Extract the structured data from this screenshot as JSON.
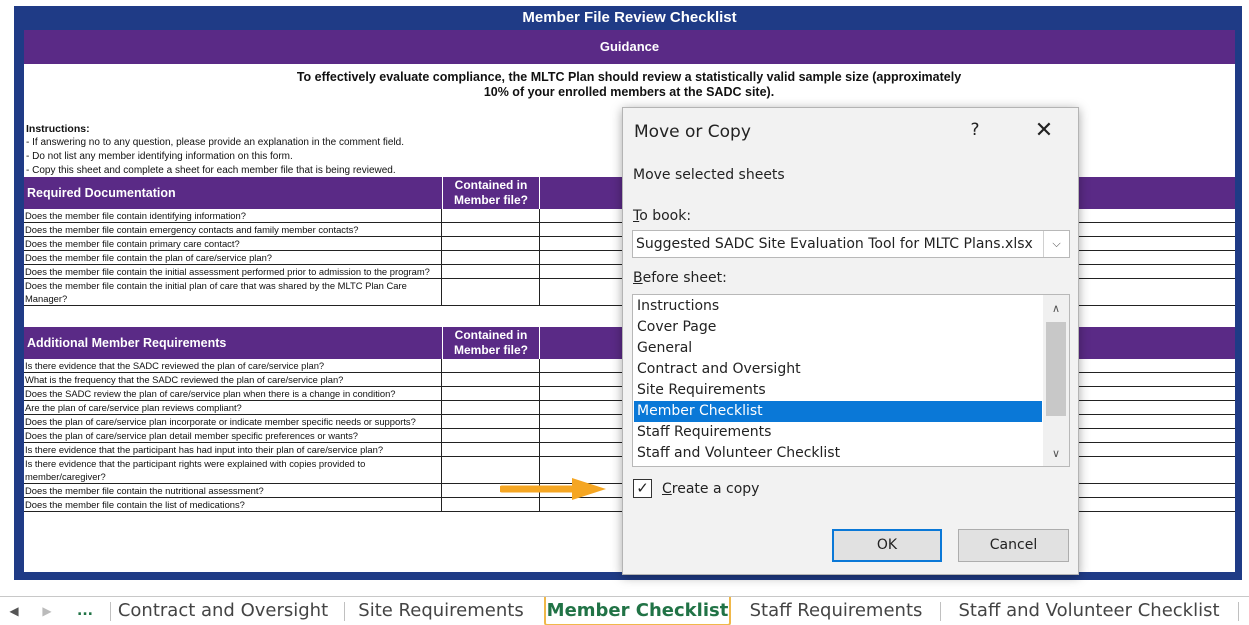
{
  "sheet": {
    "title": "Member File Review Checklist",
    "guidance": "Guidance",
    "intro_line1": "To effectively evaluate compliance, the MLTC Plan should review a statistically valid sample size (approximately",
    "intro_line2": "10% of your enrolled members at the SADC site).",
    "instructions_heading": "Instructions:",
    "instructions": [
      "- If answering no to any question, please provide an explanation in the comment field.",
      "- Do not list any member identifying information on this form.",
      "- Copy this sheet and complete a sheet for each member file that is being reviewed."
    ],
    "section1": {
      "title": "Required Documentation",
      "col_line1": "Contained in",
      "col_line2": "Member file?",
      "rows": [
        "Does the member file contain identifying information?",
        "Does the member file contain emergency contacts and family member contacts?",
        "Does the member file contain primary care contact?",
        "Does the member file contain the plan of care/service plan?",
        "Does the member file contain the initial assessment performed prior to admission to the program?",
        "Does the member file contain the initial plan of care that was shared by the MLTC Plan Care Manager?"
      ]
    },
    "section2": {
      "title": "Additional Member Requirements",
      "col_line1": "Contained in",
      "col_line2": "Member file?",
      "rows": [
        "Is there evidence that the SADC reviewed the plan of care/service plan?",
        "What is the frequency that the SADC reviewed the plan of care/service plan?",
        "Does the SADC review the plan of care/service plan when there is a change in condition?",
        "Are the plan of care/service plan reviews compliant?",
        "Does the plan of care/service plan incorporate or indicate member specific needs or supports?",
        "Does the plan of care/service plan detail member specific preferences or wants?",
        "Is there evidence that the participant has had input into their plan of care/service plan?",
        "Is there evidence that the participant rights were explained with copies provided to member/caregiver?",
        "Does the member file contain the nutritional assessment?",
        "Does the member file contain the list of medications?"
      ]
    }
  },
  "dialog": {
    "title": "Move or Copy",
    "help": "?",
    "close": "✕",
    "subtitle": "Move selected sheets",
    "to_book_label": "To book:",
    "to_book_value": "Suggested SADC Site Evaluation Tool for MLTC Plans.xlsx",
    "before_sheet_label": "Before sheet:",
    "sheets": [
      "Instructions",
      "Cover Page",
      "General",
      "Contract and Oversight",
      "Site Requirements",
      "Member Checklist",
      "Staff Requirements",
      "Staff and Volunteer Checklist"
    ],
    "selected_sheet": "Member Checklist",
    "create_copy_label": "Create a copy",
    "create_copy_checked": true,
    "ok_label": "OK",
    "cancel_label": "Cancel"
  },
  "tabs": {
    "more_label": "...",
    "items": [
      "Contract and Oversight",
      "Site Requirements",
      "Member Checklist",
      "Staff Requirements",
      "Staff and Volunteer Checklist"
    ],
    "active": "Member Checklist"
  },
  "colors": {
    "title_bar": "#1f3b86",
    "section_bar": "#5a2a86",
    "selection": "#0a78d7",
    "arrow": "#f5a623",
    "active_tab_text": "#217346",
    "active_tab_border": "#f0b84a"
  }
}
